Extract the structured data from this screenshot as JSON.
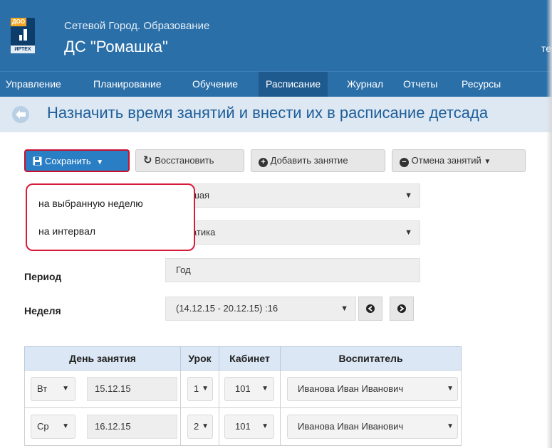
{
  "header": {
    "app_subtitle": "Сетевой Город. Образование",
    "org_name": "ДС \"Ромашка\"",
    "logo_tag": "ДОО",
    "logo_brand": "ИРТЕХ",
    "user_fragment": "те"
  },
  "nav": {
    "items": [
      {
        "label": "Управление",
        "active": false
      },
      {
        "label": "Планирование",
        "active": false
      },
      {
        "label": "Обучение",
        "active": false
      },
      {
        "label": "Расписание",
        "active": true
      },
      {
        "label": "Журнал",
        "active": false
      },
      {
        "label": "Отчеты",
        "active": false
      },
      {
        "label": "Ресурсы",
        "active": false
      }
    ]
  },
  "page": {
    "title": "Назначить время занятий и внести их в расписание детсада"
  },
  "toolbar": {
    "save_label": "Сохранить",
    "restore_label": "Восстановить",
    "add_label": "Добавить занятие",
    "cancel_label": "Отмена занятий"
  },
  "save_menu": {
    "items": [
      "на выбранную неделю",
      "на интервал"
    ]
  },
  "form": {
    "group_value": "ладшая",
    "subject_value": "тематика",
    "period_label": "Период",
    "period_value": "Год",
    "week_label": "Неделя",
    "week_value": "(14.12.15 - 20.12.15) :16"
  },
  "table": {
    "headers": [
      "День занятия",
      "Урок",
      "Кабинет",
      "Воспитатель"
    ],
    "rows": [
      {
        "day": "Вт",
        "date": "15.12.15",
        "lesson": "1",
        "room": "101",
        "teacher": "Иванова Иван Иванович"
      },
      {
        "day": "Ср",
        "date": "16.12.15",
        "lesson": "2",
        "room": "101",
        "teacher": "Иванова Иван Иванович"
      }
    ]
  },
  "colors": {
    "header_bg": "#2b6fa8",
    "title_bar_bg": "#dde8f3",
    "save_button": "#2a7fc4",
    "highlight_border": "#d81b3a"
  }
}
